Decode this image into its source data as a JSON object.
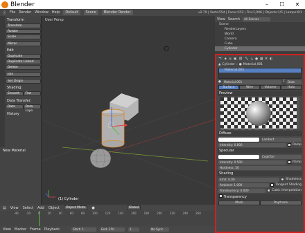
{
  "window": {
    "title": "Blender",
    "min": "–",
    "max": "☐",
    "close": "✕"
  },
  "menubar": {
    "items": [
      "File",
      "Render",
      "Window",
      "Help"
    ],
    "layout": "Default",
    "scene": "Scene",
    "engine": "Blender Render",
    "stats": "v2.79 | Verts:554 | Faces:552 | Tris:1,096 | Objects:1/5 | Lamps:0/1"
  },
  "toolshelf": {
    "transform_header": "Transform",
    "transform_buttons": [
      "Translate",
      "Rotate",
      "Scale"
    ],
    "mirror": "Mirror",
    "edit_header": "Edit",
    "edit_buttons": [
      "Duplicate",
      "Duplicate Linked",
      "Delete"
    ],
    "join": "Join",
    "set_origin": "Set Origin",
    "shading_label": "Shading:",
    "smooth": "Smooth",
    "flat": "Flat",
    "data_transfer_label": "Data Transfer:",
    "data": "Data",
    "data_layo": "Data Layo",
    "history": "History",
    "new_material": "New Material"
  },
  "viewport": {
    "label": "User Persp",
    "object_label": "(1) Cylinder",
    "header": {
      "items": [
        "View",
        "Select",
        "Add",
        "Object"
      ],
      "mode": "Object Mode",
      "pivot": "Global"
    }
  },
  "timeline": {
    "ticks": [
      "-40",
      "-20",
      "0",
      "20",
      "40",
      "60",
      "80",
      "100",
      "120",
      "140",
      "160",
      "180",
      "200",
      "220",
      "240",
      "260"
    ],
    "menu": [
      "View",
      "Marker",
      "Frame",
      "Playback"
    ],
    "start_label": "Start:",
    "start": "1",
    "end_label": "End:",
    "end": "250",
    "frame": "1",
    "sync": "No Sync"
  },
  "outliner": {
    "view": "View",
    "search": "Search",
    "scenes": "All Scenes",
    "rows": [
      "Scene",
      "RenderLayers",
      "World",
      "Camera",
      "Cube",
      "Cylinder"
    ],
    "selected_index": 5
  },
  "properties": {
    "breadcrumb_obj": "Cylinder",
    "breadcrumb_mat": "Material.001",
    "slot": "Material.001",
    "mat_field": "Material.001",
    "mat_field_f": "F",
    "data_dd": "Data",
    "tabs": [
      "Surface",
      "Wire",
      "Volume",
      "Halo"
    ],
    "active_tab": 0,
    "preview_header": "Preview",
    "diffuse_header": "Diffuse",
    "diffuse_shader": "Lambert",
    "intensity_label": "Intensity:",
    "diffuse_intensity": "0.800",
    "ramp": "Ramp",
    "specular_header": "Specular",
    "specular_shader": "CookTorr",
    "specular_intensity": "0.500",
    "hardness": "Hardness:",
    "hardness_value": "50",
    "shading_header": "Shading",
    "emit_label": "Emit:",
    "emit": "0.00",
    "ambient_label": "Ambient:",
    "ambient": "1.000",
    "translucency_label": "Translucency:",
    "translucency": "0.000",
    "shadeless": "Shadeless",
    "tangent": "Tangent Shading",
    "cubic": "Cubic Interpolation",
    "transparency_header": "Transparency",
    "mask": "Mask",
    "raytrace": "Raytrace"
  },
  "colors": {
    "accent": "#5680c2",
    "highlight_border": "#d02020"
  }
}
